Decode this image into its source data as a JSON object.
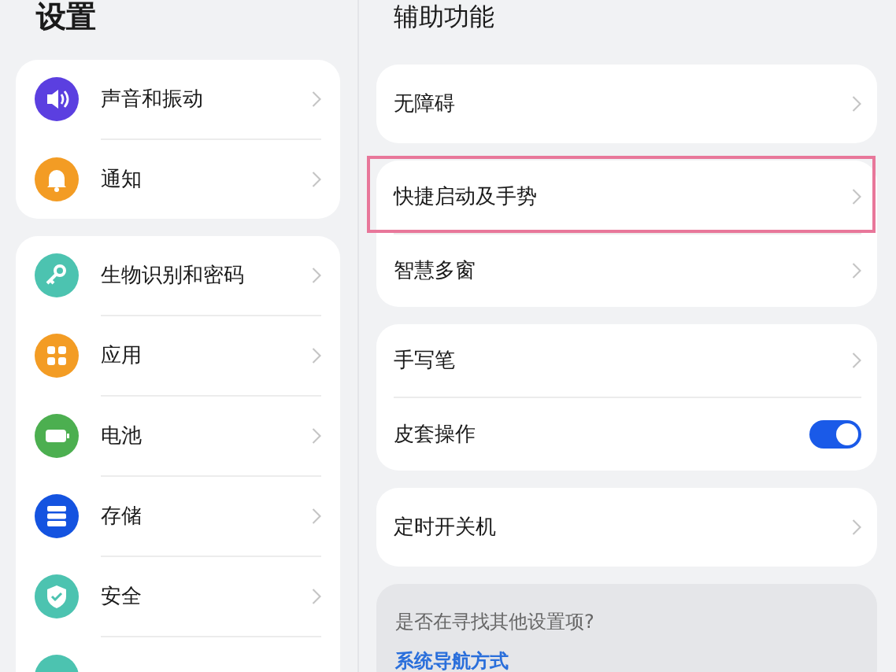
{
  "left": {
    "title": "设置",
    "groups": [
      [
        {
          "label": "声音和振动",
          "color": "#5b3fe0"
        },
        {
          "label": "通知",
          "color": "#f39c24"
        }
      ],
      [
        {
          "label": "生物识别和密码",
          "color": "#4cc3b0"
        },
        {
          "label": "应用",
          "color": "#f39c24"
        },
        {
          "label": "电池",
          "color": "#4caf50"
        },
        {
          "label": "存储",
          "color": "#1453e0"
        },
        {
          "label": "安全",
          "color": "#4cc3b0"
        },
        {
          "color": "#4cc3b0"
        }
      ]
    ]
  },
  "right": {
    "title": "辅助功能",
    "groups": [
      [
        {
          "label": "无障碍",
          "kind": "link",
          "highlighted": false
        }
      ],
      [
        {
          "label": "快捷启动及手势",
          "kind": "link",
          "highlighted": true
        },
        {
          "label": "智慧多窗",
          "kind": "link",
          "highlighted": false
        }
      ],
      [
        {
          "label": "手写笔",
          "kind": "link",
          "highlighted": false
        },
        {
          "label": "皮套操作",
          "kind": "toggle",
          "on": true,
          "highlighted": false
        }
      ],
      [
        {
          "label": "定时开关机",
          "kind": "link",
          "highlighted": false
        }
      ]
    ],
    "suggest": {
      "question": "是否在寻找其他设置项?",
      "link": "系统导航方式"
    }
  }
}
